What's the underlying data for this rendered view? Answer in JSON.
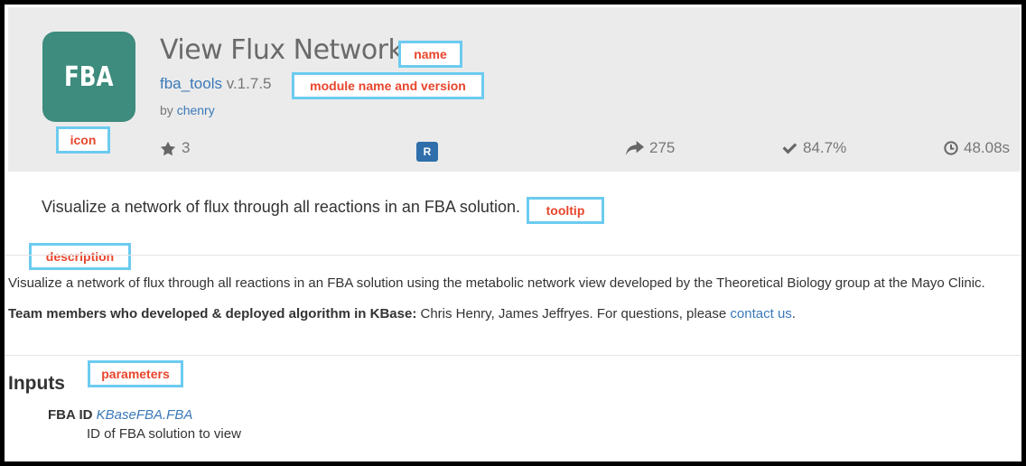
{
  "app": {
    "icon_text": "FBA",
    "icon_color": "#3d8c7d",
    "title": "View Flux Network",
    "module_name": "fba_tools",
    "module_version": " v.1.7.5",
    "author_prefix": "by ",
    "author": "chenry"
  },
  "stats": {
    "stars": "3",
    "badge": "R",
    "runs": "275",
    "success_rate": "84.7%",
    "avg_time": "48.08s"
  },
  "tooltip": "Visualize a network of flux through all reactions in an FBA solution.",
  "description": {
    "text": "Visualize a network of flux through all reactions in an FBA solution using the metabolic network view developed by the Theoretical Biology group at the Mayo Clinic.",
    "team_label": "Team members who developed & deployed algorithm in KBase:",
    "team_text": " Chris Henry, James Jeffryes. For questions, please ",
    "contact_link": "contact us",
    "team_end": "."
  },
  "inputs": {
    "heading": "Inputs",
    "params": [
      {
        "label": "FBA ID",
        "type": "KBaseFBA.FBA",
        "description": "ID of FBA solution to view"
      }
    ]
  },
  "annotations": {
    "name": "name",
    "module": "module name and version",
    "icon": "icon",
    "tooltip": "tooltip",
    "description": "description",
    "parameters": "parameters"
  },
  "colors": {
    "accent_link": "#3a79b8",
    "annotation_border": "#6ccbf0",
    "annotation_text": "#e8462c",
    "badge": "#2e6eaa"
  }
}
